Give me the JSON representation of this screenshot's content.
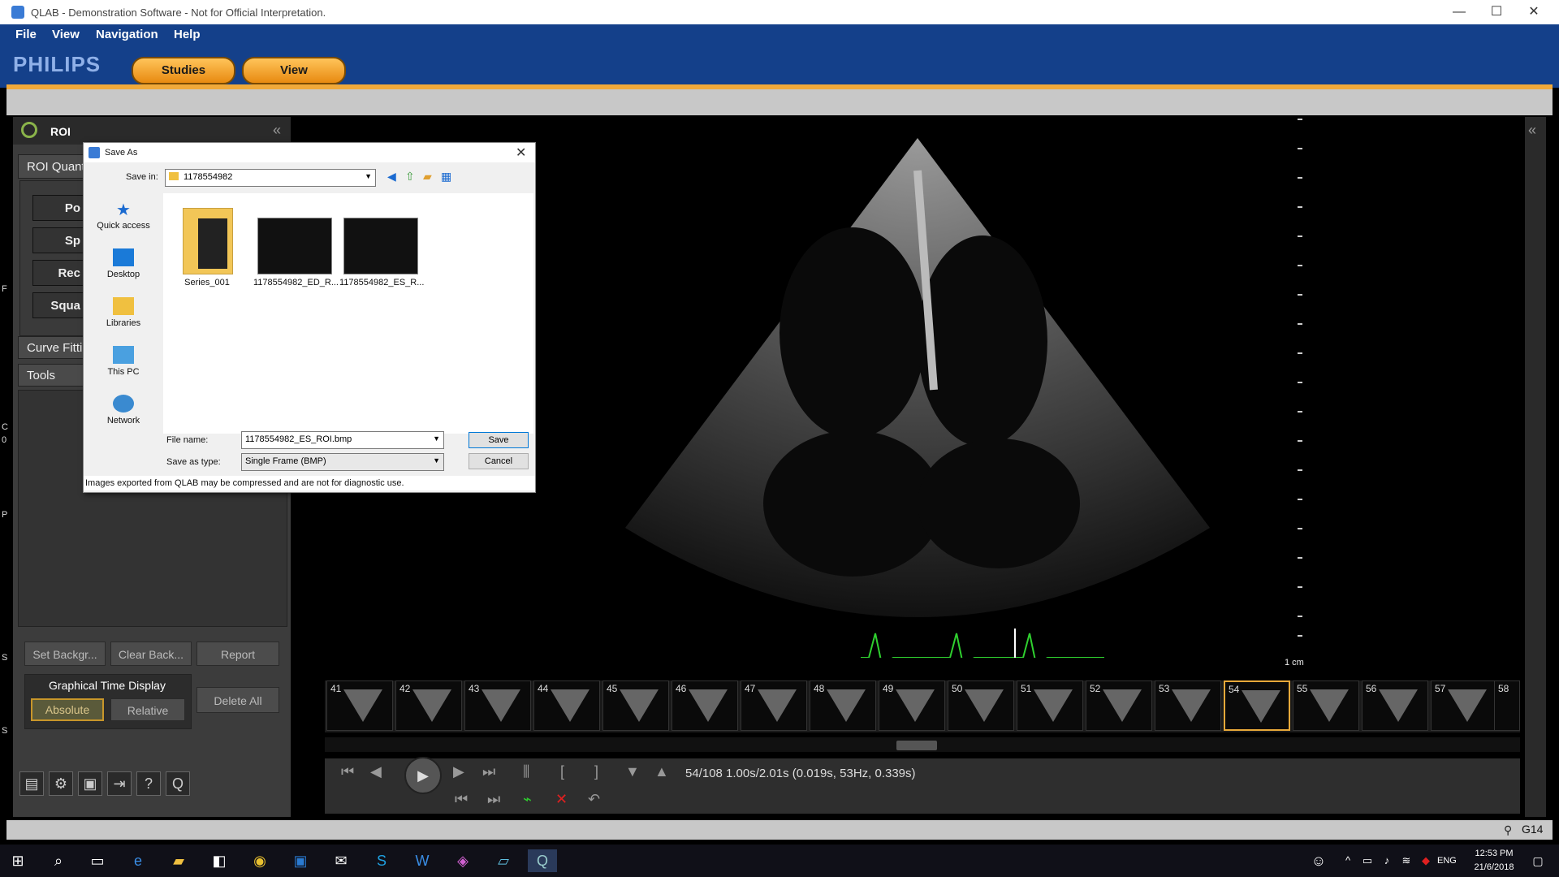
{
  "window": {
    "title": "QLAB - Demonstration Software - Not for Official Interpretation.",
    "controls": [
      "—",
      "☐",
      "✕"
    ]
  },
  "menu": [
    "File",
    "View",
    "Navigation",
    "Help"
  ],
  "brand": "PHILIPS",
  "tabs": [
    "Studies",
    "View"
  ],
  "roi_panel": {
    "title": "ROI",
    "sections": [
      "ROI Quant",
      "Curve Fitti",
      "Tools"
    ],
    "buttons": [
      "Po",
      "Sp",
      "Rec",
      "Squa"
    ],
    "actions": {
      "set_background": "Set Backgr...",
      "clear_back": "Clear Back...",
      "report": "Report",
      "delete_all": "Delete All"
    },
    "graphical_time": {
      "label": "Graphical Time Display",
      "absolute": "Absolute",
      "relative": "Relative"
    },
    "left_edge_letters": [
      "F",
      "C",
      "0",
      "P",
      "S",
      "S"
    ]
  },
  "viewer": {
    "scale_label": "1 cm",
    "frames": [
      "41",
      "42",
      "43",
      "44",
      "45",
      "46",
      "47",
      "48",
      "49",
      "50",
      "51",
      "52",
      "53",
      "54",
      "55",
      "56",
      "57",
      "58"
    ],
    "selected_frame": "54",
    "status": "54/108  1.00s/2.01s (0.019s, 53Hz, 0.339s)"
  },
  "save_dialog": {
    "title": "Save As",
    "save_in_label": "Save in:",
    "save_in_value": "1178554982",
    "nav": [
      "Quick access",
      "Desktop",
      "Libraries",
      "This PC",
      "Network"
    ],
    "files": [
      "Series_001",
      "1178554982_ED_R...",
      "1178554982_ES_R..."
    ],
    "file_name_label": "File name:",
    "file_name_value": "1178554982_ES_ROI.bmp",
    "save_type_label": "Save as type:",
    "save_type_value": "Single Frame (BMP)",
    "save_button": "Save",
    "cancel_button": "Cancel",
    "notice": "Images exported from QLAB may be compressed and are not for diagnostic use."
  },
  "status_right": "G14",
  "taskbar": {
    "time": "12:53 PM",
    "date": "21/6/2018",
    "lang": "ENG"
  }
}
